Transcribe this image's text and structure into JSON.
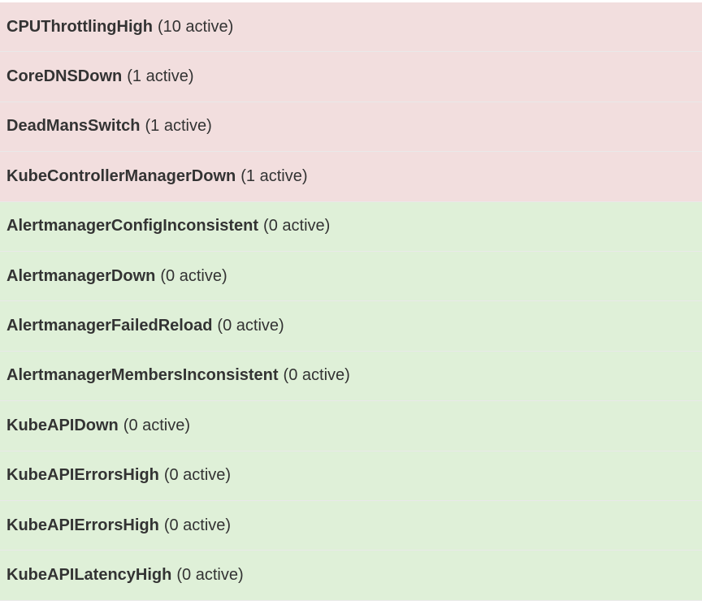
{
  "colors": {
    "firing_bg": "#f2dede",
    "inactive_bg": "#dff0d8",
    "text": "#333333",
    "divider": "#e9e9e9"
  },
  "alerts": [
    {
      "name": "CPUThrottlingHigh",
      "count": "(10 active)",
      "state": "firing"
    },
    {
      "name": "CoreDNSDown",
      "count": "(1 active)",
      "state": "firing"
    },
    {
      "name": "DeadMansSwitch",
      "count": "(1 active)",
      "state": "firing"
    },
    {
      "name": "KubeControllerManagerDown",
      "count": "(1 active)",
      "state": "firing"
    },
    {
      "name": "AlertmanagerConfigInconsistent",
      "count": "(0 active)",
      "state": "inactive"
    },
    {
      "name": "AlertmanagerDown",
      "count": "(0 active)",
      "state": "inactive"
    },
    {
      "name": "AlertmanagerFailedReload",
      "count": "(0 active)",
      "state": "inactive"
    },
    {
      "name": "AlertmanagerMembersInconsistent",
      "count": "(0 active)",
      "state": "inactive"
    },
    {
      "name": "KubeAPIDown",
      "count": "(0 active)",
      "state": "inactive"
    },
    {
      "name": "KubeAPIErrorsHigh",
      "count": "(0 active)",
      "state": "inactive"
    },
    {
      "name": "KubeAPIErrorsHigh",
      "count": "(0 active)",
      "state": "inactive"
    },
    {
      "name": "KubeAPILatencyHigh",
      "count": "(0 active)",
      "state": "inactive"
    }
  ]
}
